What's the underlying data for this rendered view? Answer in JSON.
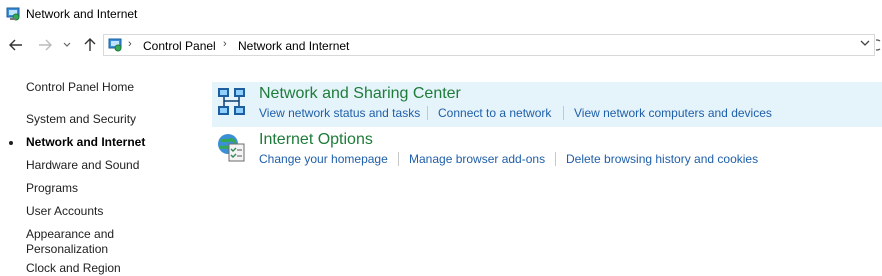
{
  "window": {
    "title": "Network and Internet"
  },
  "address_bar": {
    "breadcrumbs": [
      "Control Panel",
      "Network and Internet"
    ]
  },
  "left_nav": {
    "items": [
      {
        "label": "Control Panel Home",
        "active": false
      },
      {
        "label": "System and Security",
        "active": false
      },
      {
        "label": "Network and Internet",
        "active": true
      },
      {
        "label": "Hardware and Sound",
        "active": false
      },
      {
        "label": "Programs",
        "active": false
      },
      {
        "label": "User Accounts",
        "active": false
      },
      {
        "label": "Appearance and",
        "active": false
      },
      {
        "label": "Personalization",
        "active": false
      },
      {
        "label": "Clock and Region",
        "active": false
      }
    ]
  },
  "categories": [
    {
      "heading": "Network and Sharing Center",
      "icon": "network-sharing-icon",
      "highlighted": true,
      "links": [
        "View network status and tasks",
        "Connect to a network",
        "View network computers and devices"
      ]
    },
    {
      "heading": "Internet Options",
      "icon": "internet-options-icon",
      "highlighted": false,
      "links": [
        "Change your homepage",
        "Manage browser add-ons",
        "Delete browsing history and cookies"
      ]
    }
  ],
  "colors": {
    "heading_green": "#1e7c3a",
    "link_blue": "#1f5fa8",
    "highlight": "#e5f3fb"
  }
}
